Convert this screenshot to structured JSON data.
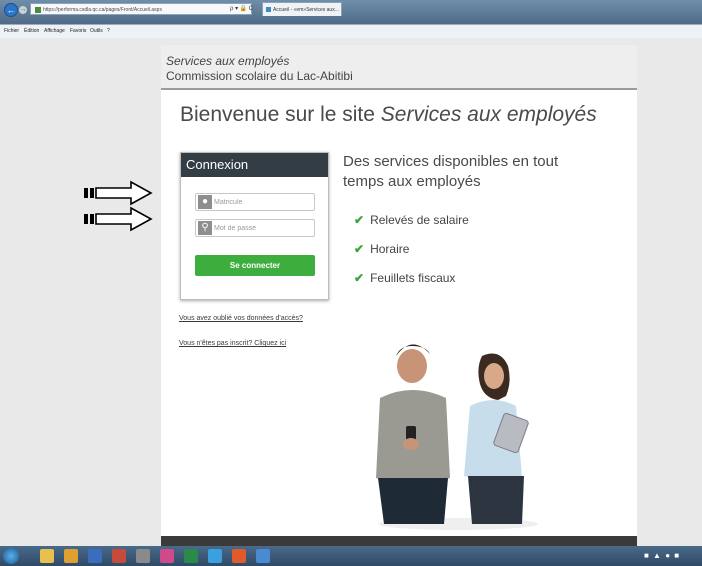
{
  "browser": {
    "address": "https://performa.csdla.qc.ca/pages/Front/Accueil.aspx",
    "address_tools": "ρ ▾ 🔒 C",
    "tab_title": "Accueil - «em»Services aux..."
  },
  "menu": {
    "items": [
      "Fichier",
      "Édition",
      "Affichage",
      "Favoris",
      "Outils",
      "?"
    ]
  },
  "header": {
    "line1": "Services aux employés",
    "line2": "Commission scolaire du Lac-Abitibi"
  },
  "welcome": {
    "prefix": "Bienvenue sur le site ",
    "emphasis": "Services aux employés"
  },
  "login": {
    "title": "Connexion",
    "username_placeholder": "Matricule",
    "password_placeholder": "Mot de passe",
    "submit_label": "Se connecter"
  },
  "links": {
    "forgot": "Vous avez oublié vos données d'accès?",
    "register": "Vous n'êtes pas inscrit? Cliquez ici"
  },
  "services": {
    "title": "Des services disponibles en tout temps aux employés",
    "items": [
      "Relevés de salaire",
      "Horaire",
      "Feuillets fiscaux"
    ]
  },
  "colors": {
    "login_header": "#333d46",
    "accent_green": "#3dae3d",
    "check_green": "#3aa53a"
  }
}
